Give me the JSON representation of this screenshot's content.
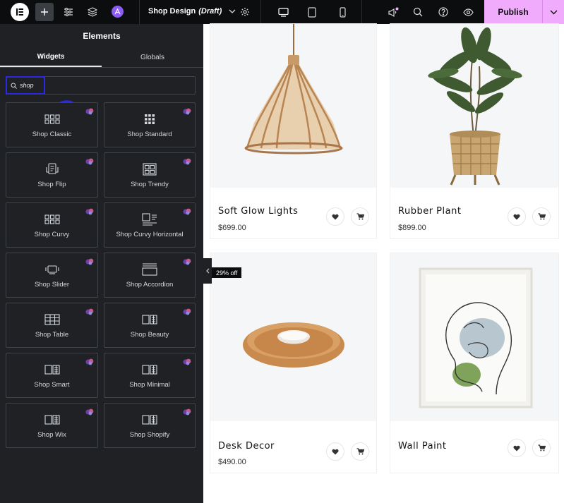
{
  "topbar": {
    "doc_title": "Shop Design",
    "doc_status": "(Draft)",
    "publish_label": "Publish"
  },
  "panel": {
    "title": "Elements",
    "tabs": [
      {
        "label": "Widgets",
        "active": true
      },
      {
        "label": "Globals",
        "active": false
      }
    ],
    "search_value": "shop",
    "widgets": [
      {
        "label": "Shop Classic",
        "icon": "grid-3x2-icon"
      },
      {
        "label": "Shop Standard",
        "icon": "grid-3x3-icon"
      },
      {
        "label": "Shop Flip",
        "icon": "flip-icon"
      },
      {
        "label": "Shop Trendy",
        "icon": "trendy-icon"
      },
      {
        "label": "Shop Curvy",
        "icon": "grid-3x2-icon"
      },
      {
        "label": "Shop Curvy Horizontal",
        "icon": "horizontal-list-icon"
      },
      {
        "label": "Shop Slider",
        "icon": "slider-icon"
      },
      {
        "label": "Shop Accordion",
        "icon": "accordion-icon"
      },
      {
        "label": "Shop Table",
        "icon": "table-icon"
      },
      {
        "label": "Shop Beauty",
        "icon": "grid-panel-icon"
      },
      {
        "label": "Shop Smart",
        "icon": "grid-panel-icon"
      },
      {
        "label": "Shop Minimal",
        "icon": "grid-panel-icon"
      },
      {
        "label": "Shop Wix",
        "icon": "grid-panel-icon"
      },
      {
        "label": "Shop Shopify",
        "icon": "grid-panel-icon"
      }
    ]
  },
  "products": [
    {
      "name": "Soft Glow Lights",
      "price": "$699.00"
    },
    {
      "name": "Rubber Plant",
      "price": "$899.00"
    },
    {
      "name": "Desk Decor",
      "price": "$490.00",
      "badge": "29% off"
    },
    {
      "name": "Wall Paint",
      "price": ""
    }
  ],
  "colors": {
    "accent": "#f0abfc",
    "panel_bg": "#1f2124",
    "topbar_bg": "#0c0d0e",
    "highlight": "#2a2ae5"
  }
}
